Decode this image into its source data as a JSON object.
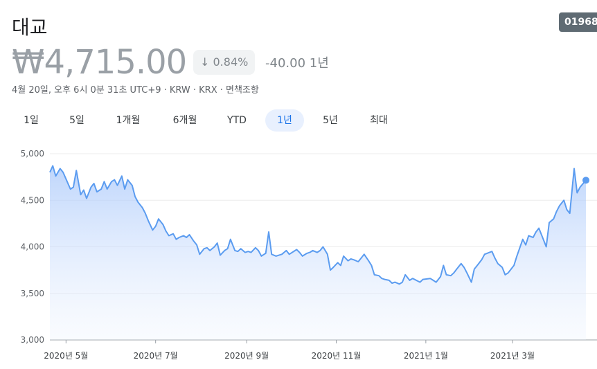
{
  "header": {
    "title": "대교",
    "ticker_badge": "01968",
    "price": "₩4,715.00",
    "change_pct": "0.84%",
    "change_abs": "-40.00 1년",
    "subline": "4월 20일, 오후 6시 0분 31초 UTC+9 · KRW · KRX · 면책조항"
  },
  "tabs": [
    {
      "label": "1일"
    },
    {
      "label": "5일"
    },
    {
      "label": "1개월"
    },
    {
      "label": "6개월"
    },
    {
      "label": "YTD"
    },
    {
      "label": "1년",
      "active": true
    },
    {
      "label": "5년"
    },
    {
      "label": "최대"
    }
  ],
  "colors": {
    "line": "#5b9cf0",
    "down_arrow": "#80868b"
  },
  "chart_data": {
    "type": "line",
    "ylim": [
      3000,
      5000
    ],
    "y_ticks": [
      "5,000",
      "4,500",
      "4,000",
      "3,500",
      "3,000"
    ],
    "x_ticks": [
      "2020년 5월",
      "2020년 7월",
      "2020년 9월",
      "2020년 11월",
      "2021년 1월",
      "2021년 3월"
    ],
    "x_tick_dates": [
      "2020-05-01",
      "2020-07-01",
      "2020-09-01",
      "2020-11-01",
      "2021-01-01",
      "2021-03-01"
    ],
    "grid": true,
    "series": [
      {
        "values": [
          [
            "2020-04-20",
            4800
          ],
          [
            "2020-04-22",
            4870
          ],
          [
            "2020-04-24",
            4760
          ],
          [
            "2020-04-27",
            4840
          ],
          [
            "2020-04-29",
            4800
          ],
          [
            "2020-05-04",
            4620
          ],
          [
            "2020-05-06",
            4640
          ],
          [
            "2020-05-08",
            4820
          ],
          [
            "2020-05-11",
            4560
          ],
          [
            "2020-05-13",
            4610
          ],
          [
            "2020-05-15",
            4520
          ],
          [
            "2020-05-18",
            4640
          ],
          [
            "2020-05-20",
            4680
          ],
          [
            "2020-05-22",
            4590
          ],
          [
            "2020-05-25",
            4620
          ],
          [
            "2020-05-27",
            4700
          ],
          [
            "2020-05-29",
            4620
          ],
          [
            "2020-06-01",
            4700
          ],
          [
            "2020-06-03",
            4720
          ],
          [
            "2020-06-05",
            4660
          ],
          [
            "2020-06-08",
            4760
          ],
          [
            "2020-06-10",
            4620
          ],
          [
            "2020-06-12",
            4720
          ],
          [
            "2020-06-15",
            4660
          ],
          [
            "2020-06-17",
            4540
          ],
          [
            "2020-06-19",
            4480
          ],
          [
            "2020-06-22",
            4420
          ],
          [
            "2020-06-24",
            4360
          ],
          [
            "2020-06-26",
            4280
          ],
          [
            "2020-06-29",
            4180
          ],
          [
            "2020-07-01",
            4220
          ],
          [
            "2020-07-03",
            4300
          ],
          [
            "2020-07-06",
            4240
          ],
          [
            "2020-07-08",
            4170
          ],
          [
            "2020-07-10",
            4120
          ],
          [
            "2020-07-13",
            4140
          ],
          [
            "2020-07-15",
            4080
          ],
          [
            "2020-07-17",
            4100
          ],
          [
            "2020-07-20",
            4120
          ],
          [
            "2020-07-22",
            4100
          ],
          [
            "2020-07-24",
            4130
          ],
          [
            "2020-07-27",
            4060
          ],
          [
            "2020-07-29",
            4020
          ],
          [
            "2020-07-31",
            3920
          ],
          [
            "2020-08-03",
            3980
          ],
          [
            "2020-08-05",
            3990
          ],
          [
            "2020-08-07",
            3960
          ],
          [
            "2020-08-10",
            4000
          ],
          [
            "2020-08-12",
            4040
          ],
          [
            "2020-08-14",
            3910
          ],
          [
            "2020-08-17",
            3960
          ],
          [
            "2020-08-19",
            3980
          ],
          [
            "2020-08-21",
            4080
          ],
          [
            "2020-08-24",
            3960
          ],
          [
            "2020-08-26",
            3950
          ],
          [
            "2020-08-28",
            3980
          ],
          [
            "2020-08-31",
            3940
          ],
          [
            "2020-09-02",
            3950
          ],
          [
            "2020-09-04",
            3940
          ],
          [
            "2020-09-07",
            3990
          ],
          [
            "2020-09-09",
            3960
          ],
          [
            "2020-09-11",
            3900
          ],
          [
            "2020-09-14",
            3930
          ],
          [
            "2020-09-16",
            4160
          ],
          [
            "2020-09-18",
            3920
          ],
          [
            "2020-09-21",
            3900
          ],
          [
            "2020-09-23",
            3910
          ],
          [
            "2020-09-25",
            3920
          ],
          [
            "2020-09-28",
            3960
          ],
          [
            "2020-09-30",
            3920
          ],
          [
            "2020-10-05",
            3970
          ],
          [
            "2020-10-07",
            3940
          ],
          [
            "2020-10-09",
            3900
          ],
          [
            "2020-10-12",
            3930
          ],
          [
            "2020-10-14",
            3940
          ],
          [
            "2020-10-16",
            3960
          ],
          [
            "2020-10-19",
            3940
          ],
          [
            "2020-10-21",
            3960
          ],
          [
            "2020-10-23",
            4000
          ],
          [
            "2020-10-26",
            3920
          ],
          [
            "2020-10-28",
            3750
          ],
          [
            "2020-10-30",
            3780
          ],
          [
            "2020-11-02",
            3830
          ],
          [
            "2020-11-04",
            3800
          ],
          [
            "2020-11-06",
            3900
          ],
          [
            "2020-11-09",
            3850
          ],
          [
            "2020-11-11",
            3870
          ],
          [
            "2020-11-13",
            3860
          ],
          [
            "2020-11-16",
            3840
          ],
          [
            "2020-11-18",
            3880
          ],
          [
            "2020-11-20",
            3920
          ],
          [
            "2020-11-23",
            3850
          ],
          [
            "2020-11-25",
            3800
          ],
          [
            "2020-11-27",
            3700
          ],
          [
            "2020-11-30",
            3690
          ],
          [
            "2020-12-02",
            3660
          ],
          [
            "2020-12-04",
            3650
          ],
          [
            "2020-12-07",
            3640
          ],
          [
            "2020-12-09",
            3610
          ],
          [
            "2020-12-11",
            3620
          ],
          [
            "2020-12-14",
            3600
          ],
          [
            "2020-12-16",
            3620
          ],
          [
            "2020-12-18",
            3700
          ],
          [
            "2020-12-21",
            3640
          ],
          [
            "2020-12-23",
            3660
          ],
          [
            "2020-12-28",
            3620
          ],
          [
            "2020-12-30",
            3650
          ],
          [
            "2021-01-04",
            3660
          ],
          [
            "2021-01-06",
            3640
          ],
          [
            "2021-01-08",
            3620
          ],
          [
            "2021-01-11",
            3680
          ],
          [
            "2021-01-13",
            3800
          ],
          [
            "2021-01-15",
            3700
          ],
          [
            "2021-01-18",
            3690
          ],
          [
            "2021-01-20",
            3720
          ],
          [
            "2021-01-22",
            3760
          ],
          [
            "2021-01-25",
            3820
          ],
          [
            "2021-01-27",
            3780
          ],
          [
            "2021-01-29",
            3720
          ],
          [
            "2021-02-01",
            3620
          ],
          [
            "2021-02-03",
            3760
          ],
          [
            "2021-02-05",
            3800
          ],
          [
            "2021-02-08",
            3860
          ],
          [
            "2021-02-10",
            3920
          ],
          [
            "2021-02-15",
            3950
          ],
          [
            "2021-02-17",
            3880
          ],
          [
            "2021-02-19",
            3820
          ],
          [
            "2021-02-22",
            3780
          ],
          [
            "2021-02-24",
            3700
          ],
          [
            "2021-02-26",
            3720
          ],
          [
            "2021-03-02",
            3800
          ],
          [
            "2021-03-04",
            3900
          ],
          [
            "2021-03-08",
            4080
          ],
          [
            "2021-03-10",
            4020
          ],
          [
            "2021-03-12",
            4120
          ],
          [
            "2021-03-15",
            4100
          ],
          [
            "2021-03-17",
            4160
          ],
          [
            "2021-03-19",
            4200
          ],
          [
            "2021-03-22",
            4080
          ],
          [
            "2021-03-24",
            4000
          ],
          [
            "2021-03-26",
            4260
          ],
          [
            "2021-03-29",
            4300
          ],
          [
            "2021-03-31",
            4380
          ],
          [
            "2021-04-02",
            4440
          ],
          [
            "2021-04-05",
            4500
          ],
          [
            "2021-04-07",
            4400
          ],
          [
            "2021-04-09",
            4360
          ],
          [
            "2021-04-12",
            4840
          ],
          [
            "2021-04-14",
            4580
          ],
          [
            "2021-04-16",
            4640
          ],
          [
            "2021-04-20",
            4715
          ]
        ]
      }
    ]
  }
}
